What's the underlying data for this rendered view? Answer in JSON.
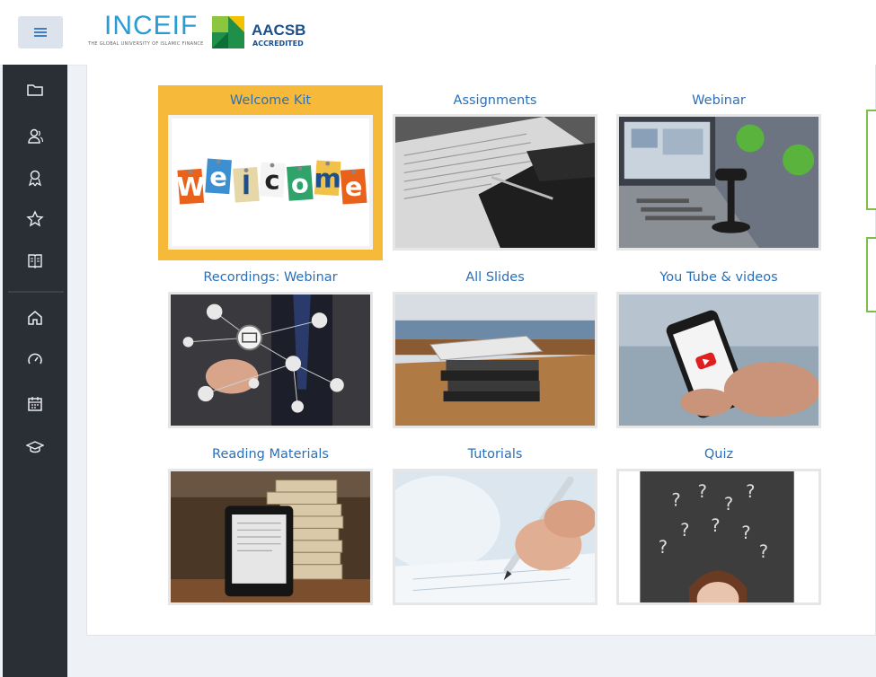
{
  "header": {
    "menu_icon": "hamburger-icon",
    "logo_inceif_text": "INCEIF",
    "logo_inceif_tagline": "THE GLOBAL UNIVERSITY OF ISLAMIC FINANCE",
    "logo_aacsb_text": "AACSB",
    "logo_aacsb_sub": "ACCREDITED"
  },
  "sidebar": {
    "items": [
      {
        "icon": "folder-icon"
      },
      {
        "icon": "users-icon"
      },
      {
        "icon": "award-icon"
      },
      {
        "icon": "star-icon"
      },
      {
        "icon": "book-icon"
      },
      {
        "icon": "home-icon"
      },
      {
        "icon": "dashboard-icon"
      },
      {
        "icon": "calendar-icon"
      },
      {
        "icon": "graduation-cap-icon"
      }
    ]
  },
  "tiles": [
    {
      "title": "Welcome Kit",
      "image": "welcome-letters",
      "active": true
    },
    {
      "title": "Assignments",
      "image": "writing-paper"
    },
    {
      "title": "Webinar",
      "image": "laptop-microphone"
    },
    {
      "title": "Recordings: Webinar",
      "image": "network-touch"
    },
    {
      "title": "All Slides",
      "image": "tablet-books"
    },
    {
      "title": "You Tube & videos",
      "image": "phone-youtube"
    },
    {
      "title": "Reading Materials",
      "image": "ereader-books"
    },
    {
      "title": "Tutorials",
      "image": "hand-pen"
    },
    {
      "title": "Quiz",
      "image": "question-marks"
    }
  ],
  "welcome_letters": [
    "W",
    "e",
    "l",
    "c",
    "o",
    "m",
    "e"
  ],
  "colors": {
    "sidebar": "#2a2e35",
    "tile_title": "#2a70b8",
    "active_tile": "#f7b93a",
    "accent_green": "#7cc04a"
  }
}
